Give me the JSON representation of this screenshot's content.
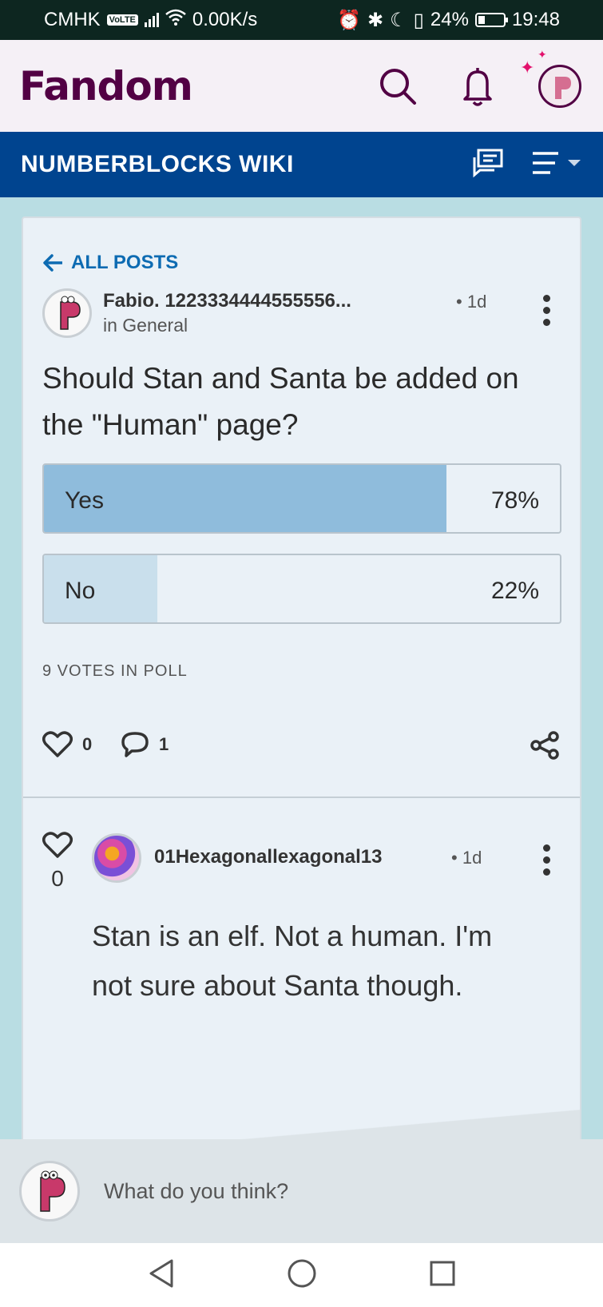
{
  "status_bar": {
    "carrier": "CMHK",
    "volte": "VoLTE",
    "speed": "0.00K/s",
    "battery": "24%",
    "time": "19:48"
  },
  "header": {
    "logo": "Fandom",
    "icons": [
      "search-icon",
      "bell-icon",
      "user-avatar"
    ]
  },
  "wiki": {
    "title": "NUMBERBLOCKS WIKI",
    "icons": [
      "discussions-icon",
      "menu-icon"
    ]
  },
  "post": {
    "back_label": "ALL POSTS",
    "author": "Fabio. 1223334444555556...",
    "time": "1d",
    "category": "in General",
    "title": "Should Stan and Santa be added on the \"Human\" page?",
    "poll": {
      "options": [
        {
          "label": "Yes",
          "percent": "78%",
          "fraction": 0.78
        },
        {
          "label": "No",
          "percent": "22%",
          "fraction": 0.22
        }
      ],
      "votes": "9 VOTES IN POLL"
    },
    "likes": "0",
    "comments": "1"
  },
  "reply": {
    "likes": "0",
    "author": "01Hexagonallexagonal13",
    "time": "1d",
    "text": "Stan is an elf. Not a human. I'm not sure about Santa though."
  },
  "composer": {
    "placeholder": "What do you think?"
  },
  "colors": {
    "fandom_purple": "#520044",
    "wiki_blue": "#00448f",
    "poll_yes": "#8fbcdc",
    "poll_no": "#c9dfec",
    "link_blue": "#0d6bb2"
  }
}
